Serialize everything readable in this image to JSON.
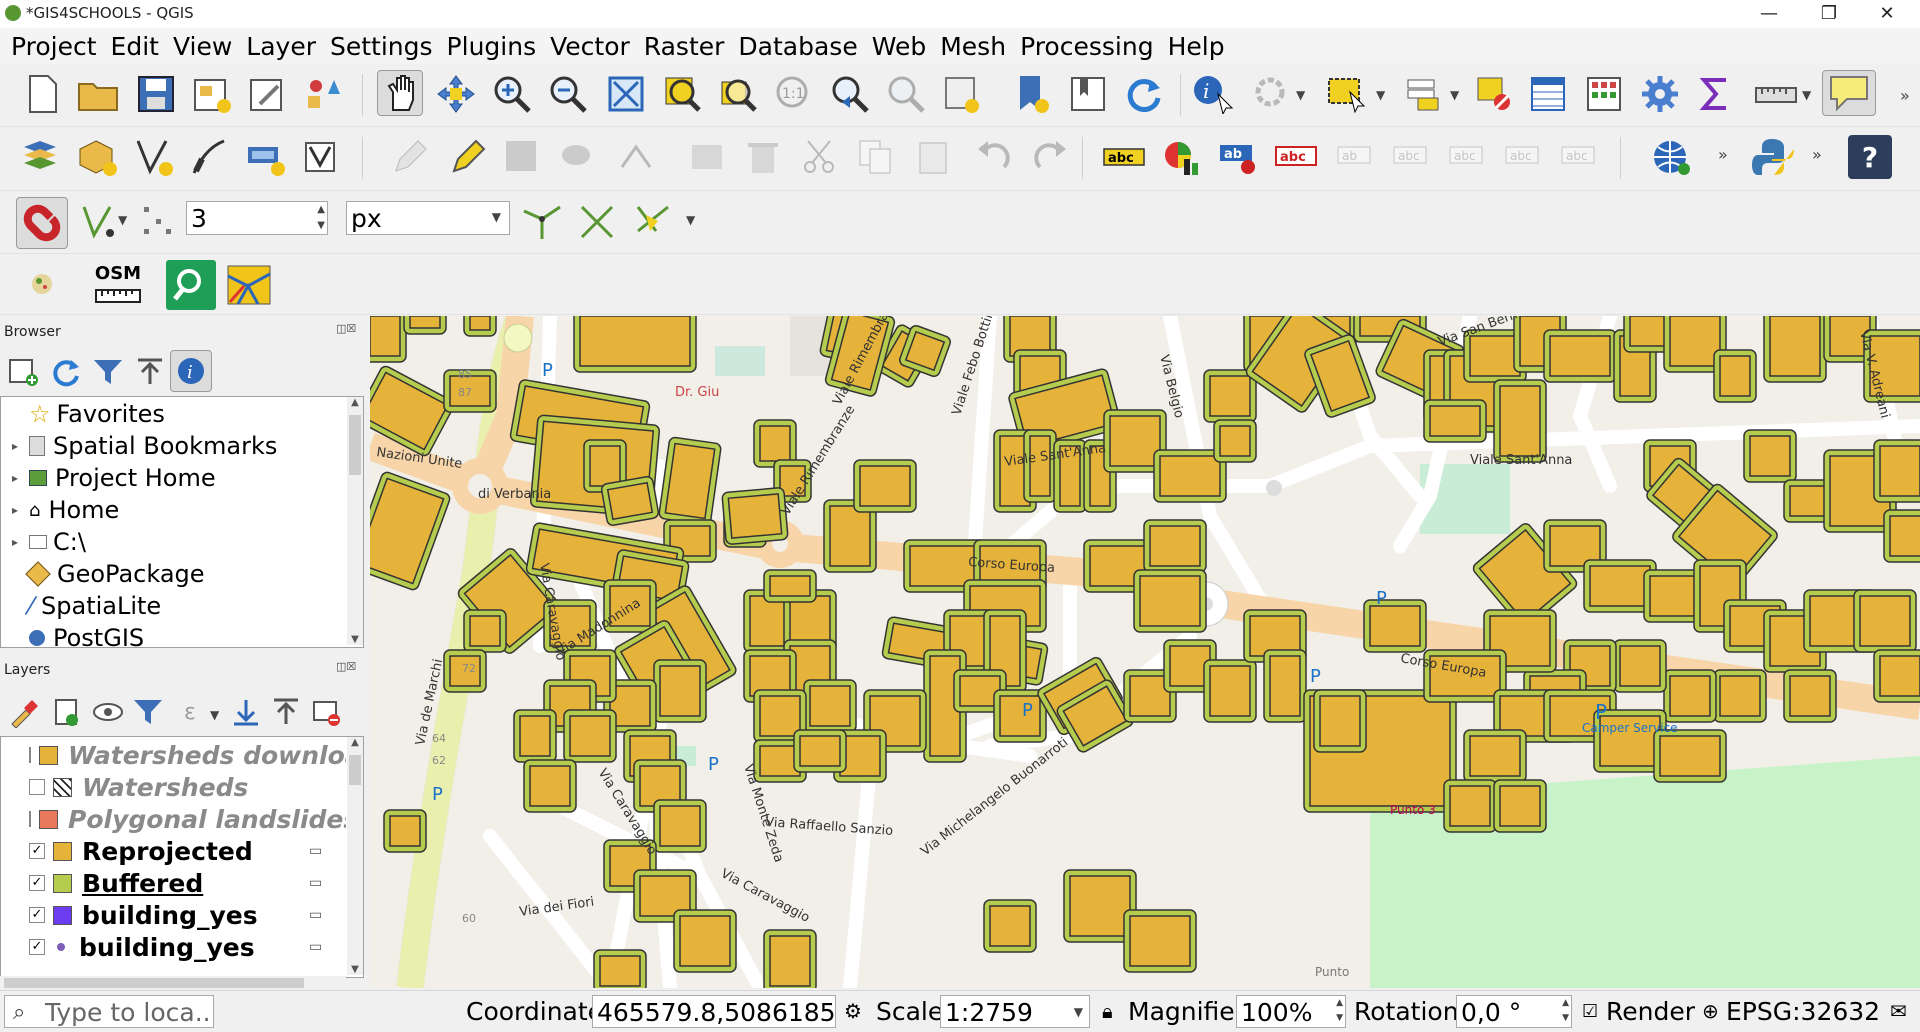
{
  "window": {
    "title": "*GIS4SCHOOLS - QGIS",
    "min": "—",
    "max": "❐",
    "close": "✕"
  },
  "menu": [
    "Project",
    "Edit",
    "View",
    "Layer",
    "Settings",
    "Plugins",
    "Vector",
    "Raster",
    "Database",
    "Web",
    "Mesh",
    "Processing",
    "Help"
  ],
  "snapping": {
    "tolerance": "3",
    "unit": "px"
  },
  "plugins_toolbar": {
    "osm_label": "OSM"
  },
  "browser": {
    "title": "Browser",
    "items": [
      "Favorites",
      "Spatial Bookmarks",
      "Project Home",
      "Home",
      "C:\\",
      "GeoPackage",
      "SpatiaLite",
      "PostGIS"
    ]
  },
  "layers": {
    "title": "Layers",
    "items": [
      {
        "name": "Watersheds downloa",
        "checked": false,
        "color": "#e6b33a"
      },
      {
        "name": "Watersheds",
        "checked": false,
        "color": "#ffffff"
      },
      {
        "name": "Polygonal landslides",
        "checked": false,
        "color": "#e8795a"
      },
      {
        "name": "Reprojected",
        "checked": true,
        "color": "#e6b33a"
      },
      {
        "name": "Buffered",
        "checked": true,
        "color": "#b5cc4e"
      },
      {
        "name": "building_yes",
        "checked": true,
        "color": "#6b3cf0"
      },
      {
        "name": "building_yes",
        "checked": true,
        "color": "#7f5fb8"
      }
    ]
  },
  "map": {
    "streets": [
      "Viale Rimembranze",
      "Viale Febo Bottini",
      "Via Belgio",
      "Via San Bernardino",
      "Via V. Adreani",
      "Viale Sant'Anna",
      "Viale Sant'Anna",
      "Corso Europa",
      "Corso Europa",
      "Via Madonnina",
      "Via Caravaggio",
      "Via Caravaggio",
      "Via Caravaggio",
      "Via Monte Zeda",
      "Via Raffaello Sanzio",
      "Via Michelangelo Buonarroti",
      "Via dei Fiori",
      "Via de Marchi",
      "Nazioni Unite",
      "di Verbania",
      "Viale Rimembranze",
      "Dr. Giu"
    ],
    "pois": [
      "Camper Service",
      "Punto 3",
      "Punto",
      "85",
      "87",
      "72",
      "64",
      "62",
      "60"
    ],
    "colors": {
      "fill": "#e6b33a",
      "buffer": "#b5cc4e",
      "road": "#f7d5a8"
    }
  },
  "status": {
    "locator_placeholder": "Type to loca...",
    "coordinate_label": "Coordinate",
    "coordinate": "465579.8,5086185.1",
    "scale_label": "Scale",
    "scale": "1:2759",
    "magnifier_label": "Magnifier",
    "magnifier": "100%",
    "rotation_label": "Rotation",
    "rotation": "0,0 °",
    "render_label": "Render",
    "crs": "EPSG:32632"
  }
}
